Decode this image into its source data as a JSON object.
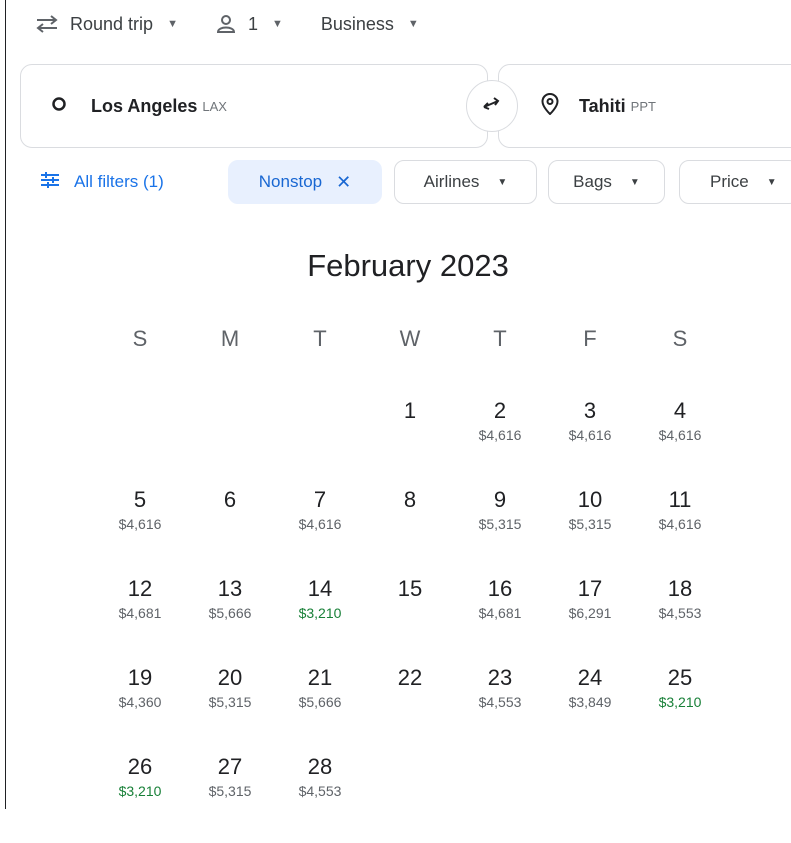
{
  "search": {
    "trip_type": "Round trip",
    "passengers": "1",
    "cabin_class": "Business",
    "origin": {
      "city": "Los Angeles",
      "code": "LAX"
    },
    "destination": {
      "city": "Tahiti",
      "code": "PPT"
    }
  },
  "filters": {
    "all_filters_label": "All filters (1)",
    "nonstop_label": "Nonstop",
    "airlines_label": "Airlines",
    "bags_label": "Bags",
    "price_label": "Price"
  },
  "calendar": {
    "month_title": "February 2023",
    "weekdays": [
      "S",
      "M",
      "T",
      "W",
      "T",
      "F",
      "S"
    ],
    "low_price_color": "#188038",
    "weeks": [
      [
        null,
        null,
        null,
        {
          "day": "1",
          "price": ""
        },
        {
          "day": "2",
          "price": "$4,616"
        },
        {
          "day": "3",
          "price": "$4,616"
        },
        {
          "day": "4",
          "price": "$4,616"
        }
      ],
      [
        {
          "day": "5",
          "price": "$4,616"
        },
        {
          "day": "6",
          "price": ""
        },
        {
          "day": "7",
          "price": "$4,616"
        },
        {
          "day": "8",
          "price": ""
        },
        {
          "day": "9",
          "price": "$5,315"
        },
        {
          "day": "10",
          "price": "$5,315"
        },
        {
          "day": "11",
          "price": "$4,616"
        }
      ],
      [
        {
          "day": "12",
          "price": "$4,681"
        },
        {
          "day": "13",
          "price": "$5,666"
        },
        {
          "day": "14",
          "price": "$3,210",
          "low": true
        },
        {
          "day": "15",
          "price": ""
        },
        {
          "day": "16",
          "price": "$4,681"
        },
        {
          "day": "17",
          "price": "$6,291"
        },
        {
          "day": "18",
          "price": "$4,553"
        }
      ],
      [
        {
          "day": "19",
          "price": "$4,360"
        },
        {
          "day": "20",
          "price": "$5,315"
        },
        {
          "day": "21",
          "price": "$5,666"
        },
        {
          "day": "22",
          "price": ""
        },
        {
          "day": "23",
          "price": "$4,553"
        },
        {
          "day": "24",
          "price": "$3,849"
        },
        {
          "day": "25",
          "price": "$3,210",
          "low": true
        }
      ],
      [
        {
          "day": "26",
          "price": "$3,210",
          "low": true
        },
        {
          "day": "27",
          "price": "$5,315"
        },
        {
          "day": "28",
          "price": "$4,553"
        },
        null,
        null,
        null,
        null
      ]
    ]
  }
}
